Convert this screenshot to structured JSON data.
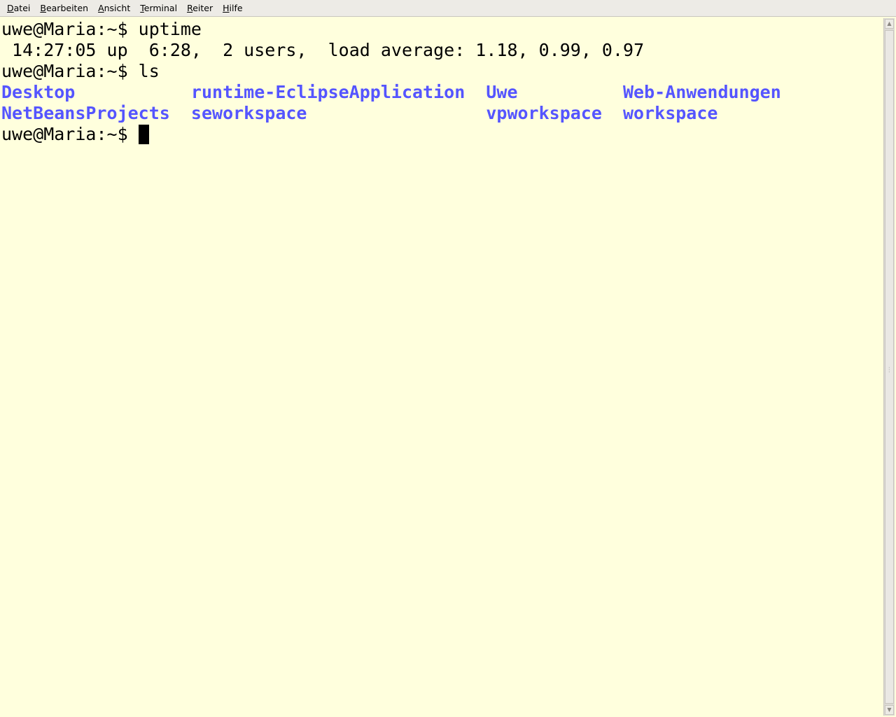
{
  "menubar": {
    "items": [
      {
        "mnemonic": "D",
        "rest": "atei"
      },
      {
        "mnemonic": "B",
        "rest": "earbeiten"
      },
      {
        "mnemonic": "A",
        "rest": "nsicht"
      },
      {
        "mnemonic": "T",
        "rest": "erminal"
      },
      {
        "mnemonic": "R",
        "rest": "eiter"
      },
      {
        "mnemonic": "H",
        "rest": "ilfe"
      }
    ]
  },
  "terminal": {
    "prompt": "uwe@Maria:~$ ",
    "cmd1": "uptime",
    "uptime_output": " 14:27:05 up  6:28,  2 users,  load average: 1.18, 0.99, 0.97",
    "cmd2": "ls",
    "ls_rows": [
      [
        "Desktop",
        "runtime-EclipseApplication",
        "Uwe",
        "Web-Anwendungen"
      ],
      [
        "NetBeansProjects",
        "seworkspace",
        "vpworkspace",
        "workspace"
      ]
    ],
    "directory_color": "#5555ff",
    "background_color": "#ffffdd"
  },
  "scrollbar": {
    "up_icon": "arrow-up",
    "down_icon": "arrow-down"
  }
}
